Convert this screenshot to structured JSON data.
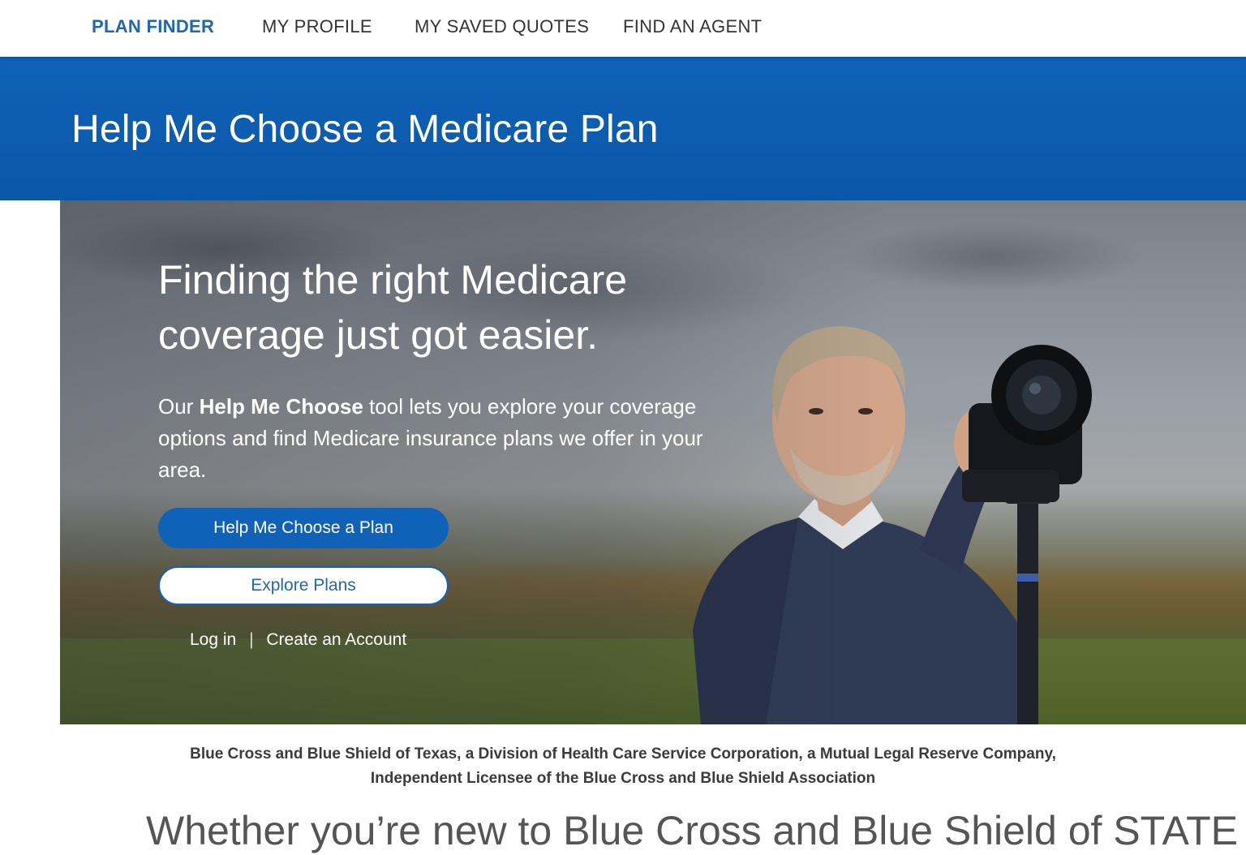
{
  "nav": {
    "items": [
      {
        "label": "PLAN FINDER",
        "active": true
      },
      {
        "label": "MY PROFILE",
        "active": false
      },
      {
        "label": "MY SAVED QUOTES",
        "active": false
      },
      {
        "label": "FIND AN AGENT",
        "active": false
      }
    ]
  },
  "banner": {
    "title": "Help Me Choose a Medicare Plan"
  },
  "hero": {
    "headline": "Finding the right Medicare coverage just got easier.",
    "body_prefix": "Our ",
    "body_bold": "Help Me Choose",
    "body_suffix": " tool lets you explore your coverage options and find Medicare insurance plans we offer in your area.",
    "primary_button": "Help Me Choose a Plan",
    "secondary_button": "Explore Plans",
    "login_link": "Log in",
    "separator": "|",
    "create_account_link": "Create an Account"
  },
  "disclaimer": {
    "line1": "Blue Cross and Blue Shield of Texas, a Division of Health Care Service Corporation, a Mutual Legal Reserve Company,",
    "line2": "Independent Licensee of the Blue Cross and Blue Shield Association"
  },
  "section": {
    "heading": "Whether you’re new to Blue Cross and Blue Shield of STATE or"
  },
  "colors": {
    "brand_blue": "#0f62b8",
    "active_nav": "#1f66b3",
    "text_dark": "#333333"
  }
}
